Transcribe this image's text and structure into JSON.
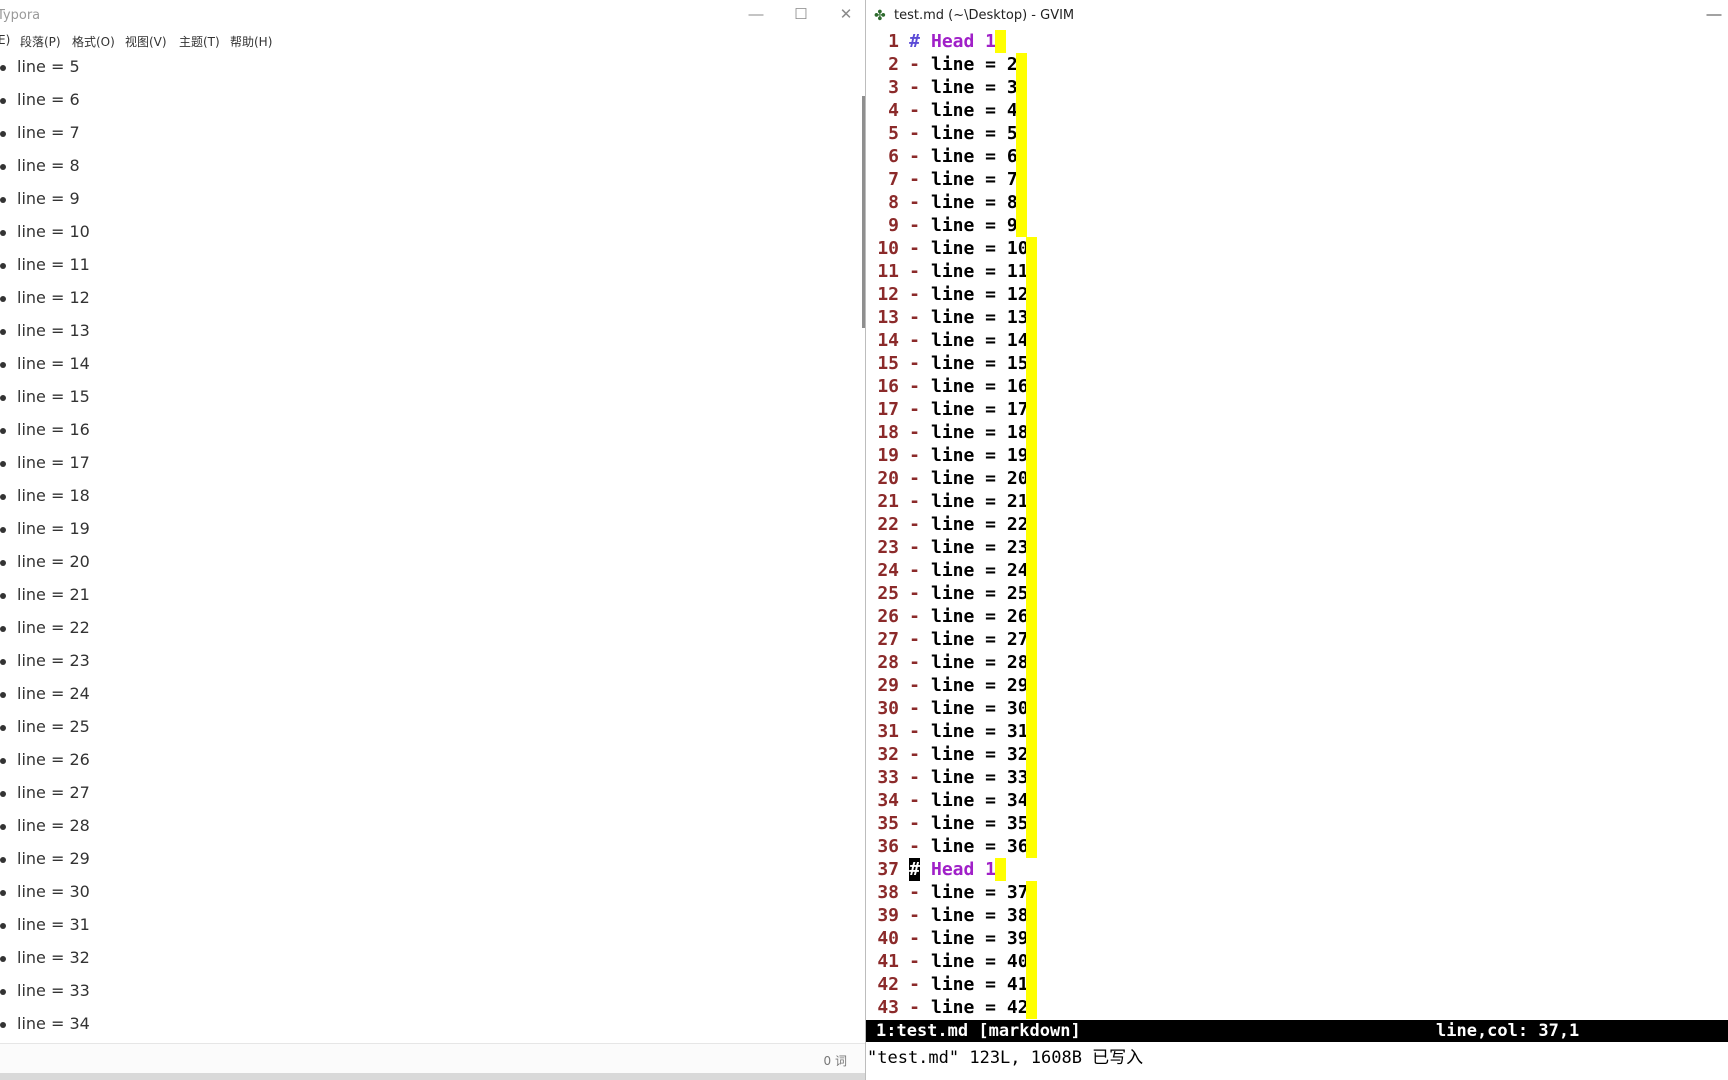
{
  "typora": {
    "title": "Typora",
    "window_buttons": {
      "minimize": "—",
      "maximize": "☐",
      "close": "✕"
    },
    "menu": [
      "E)",
      "段落(P)",
      "格式(O)",
      "视图(V)",
      "主题(T)",
      "帮助(H)"
    ],
    "items": [
      "line = 5",
      "line = 6",
      "line = 7",
      "line = 8",
      "line = 9",
      "line = 10",
      "line = 11",
      "line = 12",
      "line = 13",
      "line = 14",
      "line = 15",
      "line = 16",
      "line = 17",
      "line = 18",
      "line = 19",
      "line = 20",
      "line = 21",
      "line = 22",
      "line = 23",
      "line = 24",
      "line = 25",
      "line = 26",
      "line = 27",
      "line = 28",
      "line = 29",
      "line = 30",
      "line = 31",
      "line = 32",
      "line = 33",
      "line = 34"
    ],
    "word_count": "0 词"
  },
  "gvim": {
    "title": "test.md (~\\Desktop) - GVIM",
    "window_buttons": {
      "minimize": "—"
    },
    "lines": [
      {
        "nr": "1",
        "mark": "#",
        "text": "Head 1",
        "type": "head"
      },
      {
        "nr": "2",
        "mark": "-",
        "text": "line = 2",
        "type": "list"
      },
      {
        "nr": "3",
        "mark": "-",
        "text": "line = 3",
        "type": "list"
      },
      {
        "nr": "4",
        "mark": "-",
        "text": "line = 4",
        "type": "list"
      },
      {
        "nr": "5",
        "mark": "-",
        "text": "line = 5",
        "type": "list"
      },
      {
        "nr": "6",
        "mark": "-",
        "text": "line = 6",
        "type": "list"
      },
      {
        "nr": "7",
        "mark": "-",
        "text": "line = 7",
        "type": "list"
      },
      {
        "nr": "8",
        "mark": "-",
        "text": "line = 8",
        "type": "list"
      },
      {
        "nr": "9",
        "mark": "-",
        "text": "line = 9",
        "type": "list"
      },
      {
        "nr": "10",
        "mark": "-",
        "text": "line = 10",
        "type": "list"
      },
      {
        "nr": "11",
        "mark": "-",
        "text": "line = 11",
        "type": "list"
      },
      {
        "nr": "12",
        "mark": "-",
        "text": "line = 12",
        "type": "list"
      },
      {
        "nr": "13",
        "mark": "-",
        "text": "line = 13",
        "type": "list"
      },
      {
        "nr": "14",
        "mark": "-",
        "text": "line = 14",
        "type": "list"
      },
      {
        "nr": "15",
        "mark": "-",
        "text": "line = 15",
        "type": "list"
      },
      {
        "nr": "16",
        "mark": "-",
        "text": "line = 16",
        "type": "list"
      },
      {
        "nr": "17",
        "mark": "-",
        "text": "line = 17",
        "type": "list"
      },
      {
        "nr": "18",
        "mark": "-",
        "text": "line = 18",
        "type": "list"
      },
      {
        "nr": "19",
        "mark": "-",
        "text": "line = 19",
        "type": "list"
      },
      {
        "nr": "20",
        "mark": "-",
        "text": "line = 20",
        "type": "list"
      },
      {
        "nr": "21",
        "mark": "-",
        "text": "line = 21",
        "type": "list"
      },
      {
        "nr": "22",
        "mark": "-",
        "text": "line = 22",
        "type": "list"
      },
      {
        "nr": "23",
        "mark": "-",
        "text": "line = 23",
        "type": "list"
      },
      {
        "nr": "24",
        "mark": "-",
        "text": "line = 24",
        "type": "list"
      },
      {
        "nr": "25",
        "mark": "-",
        "text": "line = 25",
        "type": "list"
      },
      {
        "nr": "26",
        "mark": "-",
        "text": "line = 26",
        "type": "list"
      },
      {
        "nr": "27",
        "mark": "-",
        "text": "line = 27",
        "type": "list"
      },
      {
        "nr": "28",
        "mark": "-",
        "text": "line = 28",
        "type": "list"
      },
      {
        "nr": "29",
        "mark": "-",
        "text": "line = 29",
        "type": "list"
      },
      {
        "nr": "30",
        "mark": "-",
        "text": "line = 30",
        "type": "list"
      },
      {
        "nr": "31",
        "mark": "-",
        "text": "line = 31",
        "type": "list"
      },
      {
        "nr": "32",
        "mark": "-",
        "text": "line = 32",
        "type": "list"
      },
      {
        "nr": "33",
        "mark": "-",
        "text": "line = 33",
        "type": "list"
      },
      {
        "nr": "34",
        "mark": "-",
        "text": "line = 34",
        "type": "list"
      },
      {
        "nr": "35",
        "mark": "-",
        "text": "line = 35",
        "type": "list"
      },
      {
        "nr": "36",
        "mark": "-",
        "text": "line = 36",
        "type": "list"
      },
      {
        "nr": "37",
        "mark": "#",
        "text": "Head 1",
        "type": "head",
        "cursor": true
      },
      {
        "nr": "38",
        "mark": "-",
        "text": "line = 37",
        "type": "list"
      },
      {
        "nr": "39",
        "mark": "-",
        "text": "line = 38",
        "type": "list"
      },
      {
        "nr": "40",
        "mark": "-",
        "text": "line = 39",
        "type": "list"
      },
      {
        "nr": "41",
        "mark": "-",
        "text": "line = 40",
        "type": "list"
      },
      {
        "nr": "42",
        "mark": "-",
        "text": "line = 41",
        "type": "list"
      },
      {
        "nr": "43",
        "mark": "-",
        "text": "line = 42",
        "type": "list"
      }
    ],
    "status_left": "1:test.md [markdown]",
    "status_right": "line,col: 37,1",
    "cmdline": "\"test.md\" 123L, 1608B 已写入"
  },
  "colors": {
    "line_number": "#8b2a2a",
    "heading": "#a020c8",
    "hash": "#5b4bd6",
    "trailing_whitespace": "#ffff00"
  }
}
